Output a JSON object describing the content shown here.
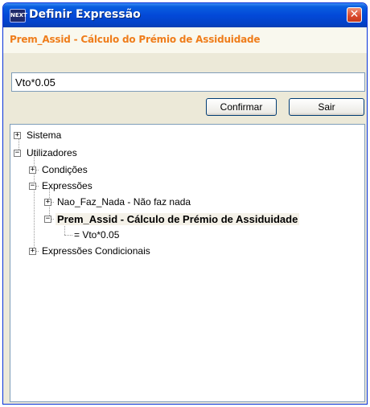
{
  "window": {
    "title": "Definir Expressão",
    "app_icon_text": "NEXT",
    "close_symbol": "✕"
  },
  "header": {
    "subtitle": "Prem_Assid - Cálculo do Prémio de Assiduidade"
  },
  "expression": {
    "value": "Vto*0.05"
  },
  "buttons": {
    "confirm_label": "Confirmar",
    "exit_label": "Sair"
  },
  "tree": {
    "nodes": [
      {
        "label": "Sistema",
        "expander": "+"
      },
      {
        "label": "Utilizadores",
        "expander": "−"
      },
      {
        "label": "Condições",
        "expander": "+"
      },
      {
        "label": "Expressões",
        "expander": "−"
      },
      {
        "label": "Nao_Faz_Nada - Não faz nada",
        "expander": "+"
      },
      {
        "label": "Prem_Assid - Cálculo de Prémio de Assiduidade",
        "expander": "−"
      },
      {
        "label": "= Vto*0.05",
        "expander": ""
      },
      {
        "label": "Expressões Condicionais",
        "expander": "+"
      }
    ]
  },
  "colors": {
    "title_bar": "#0349d8",
    "subtitle": "#ef7d1b",
    "close_button": "#d9472a",
    "window_body": "#ece9d8"
  }
}
